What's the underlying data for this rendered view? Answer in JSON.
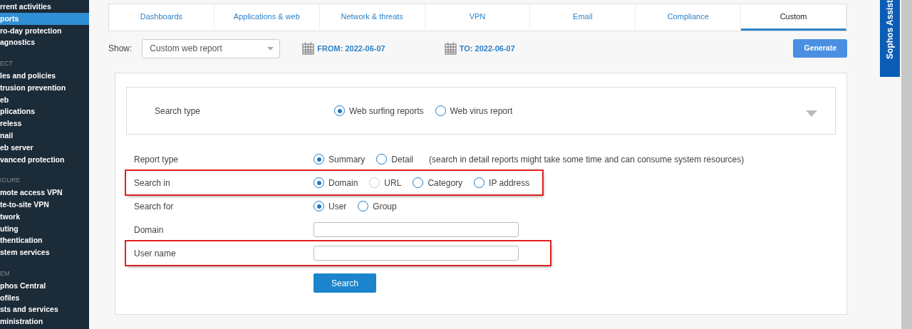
{
  "sidebar": {
    "groups": [
      {
        "items": [
          {
            "label": "rrent activities",
            "selected": false
          },
          {
            "label": "ports",
            "selected": true
          },
          {
            "label": "ro-day protection",
            "selected": false
          },
          {
            "label": "agnostics",
            "selected": false
          }
        ]
      },
      {
        "heading": "ECT",
        "items": [
          {
            "label": "les and policies",
            "selected": false
          },
          {
            "label": "trusion prevention",
            "selected": false
          },
          {
            "label": "eb",
            "selected": false
          },
          {
            "label": "plications",
            "selected": false
          },
          {
            "label": "reless",
            "selected": false
          },
          {
            "label": "nail",
            "selected": false
          },
          {
            "label": "eb server",
            "selected": false
          },
          {
            "label": "vanced protection",
            "selected": false
          }
        ]
      },
      {
        "heading": "IGURE",
        "items": [
          {
            "label": "mote access VPN",
            "selected": false
          },
          {
            "label": "te-to-site VPN",
            "selected": false
          },
          {
            "label": "twork",
            "selected": false
          },
          {
            "label": "uting",
            "selected": false
          },
          {
            "label": "thentication",
            "selected": false
          },
          {
            "label": "stem services",
            "selected": false
          }
        ]
      },
      {
        "heading": "EM",
        "items": [
          {
            "label": "phos Central",
            "selected": false
          },
          {
            "label": "ofiles",
            "selected": false
          },
          {
            "label": "sts and services",
            "selected": false
          },
          {
            "label": "ministration",
            "selected": false
          }
        ]
      }
    ]
  },
  "tabs": [
    {
      "label": "Dashboards",
      "selected": false
    },
    {
      "label": "Applications & web",
      "selected": false
    },
    {
      "label": "Network & threats",
      "selected": false
    },
    {
      "label": "VPN",
      "selected": false
    },
    {
      "label": "Email",
      "selected": false
    },
    {
      "label": "Compliance",
      "selected": false
    },
    {
      "label": "Custom",
      "selected": true
    }
  ],
  "toolbar": {
    "show_label": "Show:",
    "report_select": "Custom web report",
    "from": "FROM: 2022-06-07",
    "to": "TO: 2022-06-07",
    "generate_button": "Generate"
  },
  "search_type": {
    "label": "Search type",
    "options": [
      {
        "label": "Web surfing reports",
        "selected": true,
        "disabled": false
      },
      {
        "label": "Web virus report",
        "selected": false,
        "disabled": false
      }
    ]
  },
  "form_rows": [
    {
      "kind": "radio",
      "label": "Report type",
      "highlighted": false,
      "options": [
        {
          "label": "Summary",
          "selected": true,
          "disabled": false
        },
        {
          "label": "Detail",
          "selected": false,
          "disabled": false
        }
      ],
      "note": "(search in detail reports might take some time and can consume system resources)"
    },
    {
      "kind": "radio",
      "label": "Search in",
      "highlighted": true,
      "options": [
        {
          "label": "Domain",
          "selected": true,
          "disabled": false
        },
        {
          "label": "URL",
          "selected": false,
          "disabled": true
        },
        {
          "label": "Category",
          "selected": false,
          "disabled": false
        },
        {
          "label": "IP address",
          "selected": false,
          "disabled": false
        }
      ]
    },
    {
      "kind": "radio",
      "label": "Search for",
      "highlighted": false,
      "options": [
        {
          "label": "User",
          "selected": true,
          "disabled": false
        },
        {
          "label": "Group",
          "selected": false,
          "disabled": false
        }
      ]
    },
    {
      "kind": "text",
      "label": "Domain",
      "highlighted": false
    },
    {
      "kind": "text",
      "label": "User name",
      "highlighted": true
    }
  ],
  "search_button": "Search",
  "assistant_tab": "Sophos Assist"
}
